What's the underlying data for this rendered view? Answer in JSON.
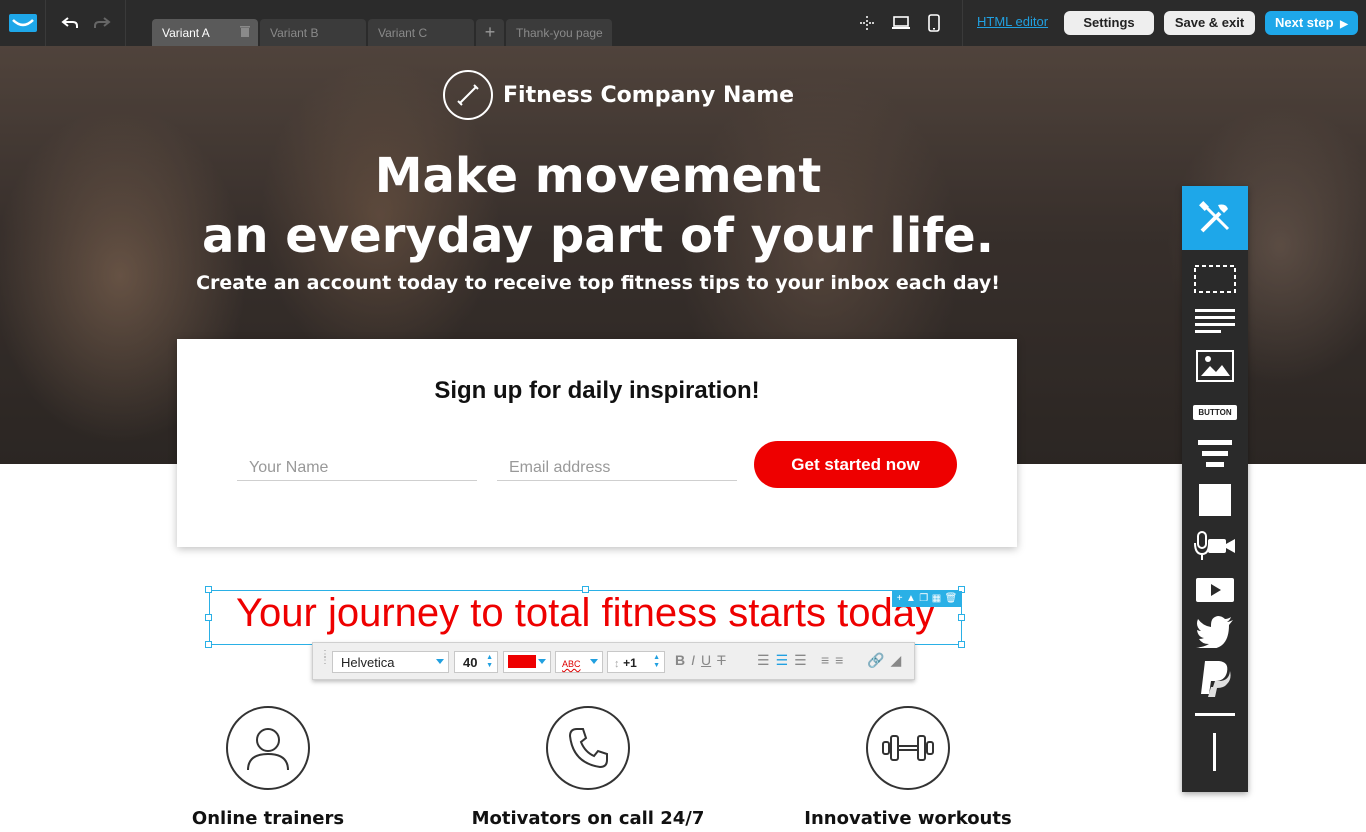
{
  "topbar": {
    "tabs": [
      {
        "label": "Variant A",
        "active": true
      },
      {
        "label": "Variant B",
        "active": false
      },
      {
        "label": "Variant C",
        "active": false
      }
    ],
    "add_tab_label": "+",
    "thankyou_tab_label": "Thank-you page",
    "html_editor_label": "HTML editor",
    "settings_label": "Settings",
    "save_exit_label": "Save & exit",
    "next_step_label": "Next step",
    "accent": "#1ea7e9"
  },
  "hero": {
    "brand_name": "Fitness Company Name",
    "headline_line1": "Make movement",
    "headline_line2": "an everyday part of your life.",
    "subheadline": "Create an account today to receive top fitness tips to your inbox each day!"
  },
  "signup": {
    "title": "Sign up for daily inspiration!",
    "name_placeholder": "Your Name",
    "email_placeholder": "Email address",
    "cta_label": "Get started now",
    "cta_color": "#ee0000"
  },
  "editor": {
    "selected_text": "Your journey to total fitness starts today",
    "font_family": "Helvetica",
    "font_size": "40",
    "text_color": "#ee0000",
    "spell_label": "ABC",
    "line_spacing": "+1"
  },
  "features": [
    {
      "label": "Online trainers",
      "icon": "user-icon"
    },
    {
      "label": "Motivators on call 24/7",
      "icon": "phone-icon"
    },
    {
      "label": "Innovative workouts",
      "icon": "dumbbell-icon"
    }
  ],
  "widgets": {
    "button_label": "BUTTON",
    "items": [
      "tools-icon",
      "section-icon",
      "text-icon",
      "image-icon",
      "button-widget",
      "lines-icon",
      "box-icon",
      "audio-video-icon",
      "play-icon",
      "twitter-icon",
      "paypal-icon",
      "horizontal-line-icon",
      "vertical-line-icon"
    ]
  }
}
